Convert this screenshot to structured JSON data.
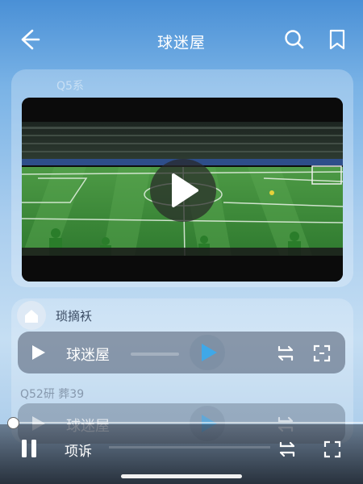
{
  "header": {
    "title": "球迷屋"
  },
  "ghost_card": {
    "label": "Q5系"
  },
  "video": {
    "caption": ""
  },
  "card2": {
    "title": "琐摘袄"
  },
  "player_bar": {
    "label": "球迷屋"
  },
  "ghost_meta": "Q52研 葬39",
  "player_bar2": {
    "label": "球迷屋"
  },
  "bottom_bar": {
    "label": "项诉",
    "progress": 0.0
  },
  "icons": [
    "back-arrow-icon",
    "search-icon",
    "bookmark-icon",
    "play-icon",
    "pause-icon",
    "repeat-icon",
    "fullscreen-icon",
    "home-icon"
  ],
  "colors": {
    "accent": "#3fa8e8",
    "pitch": "#3f8a3a"
  }
}
